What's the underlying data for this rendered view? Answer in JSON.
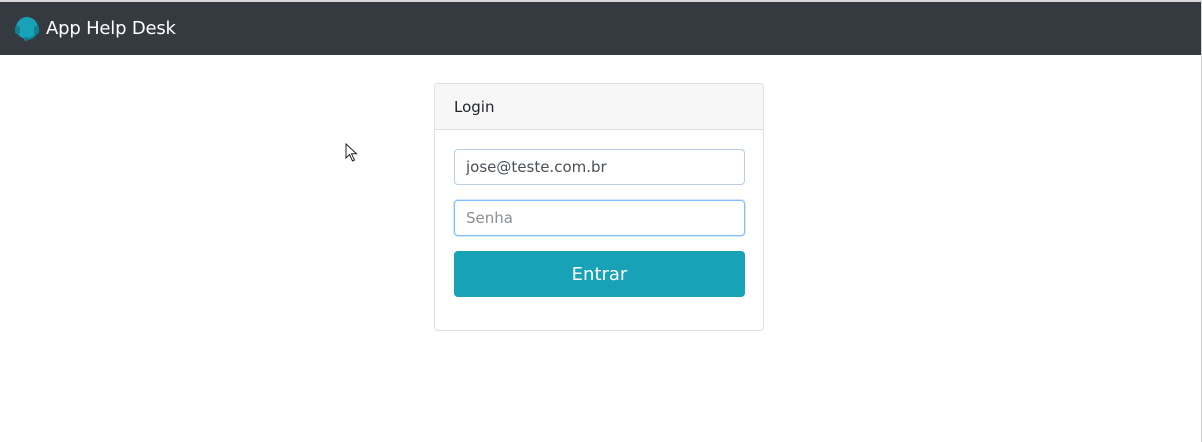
{
  "navbar": {
    "brand_icon": "headset-icon",
    "brand_text": "App Help Desk",
    "background": "#343a40"
  },
  "login_card": {
    "header": "Login",
    "email": {
      "value": "jose@teste.com.br"
    },
    "password": {
      "placeholder": "Senha"
    },
    "submit_label": "Entrar",
    "accent": "#17a2b8"
  },
  "cursor_icon": "mouse-pointer-icon"
}
